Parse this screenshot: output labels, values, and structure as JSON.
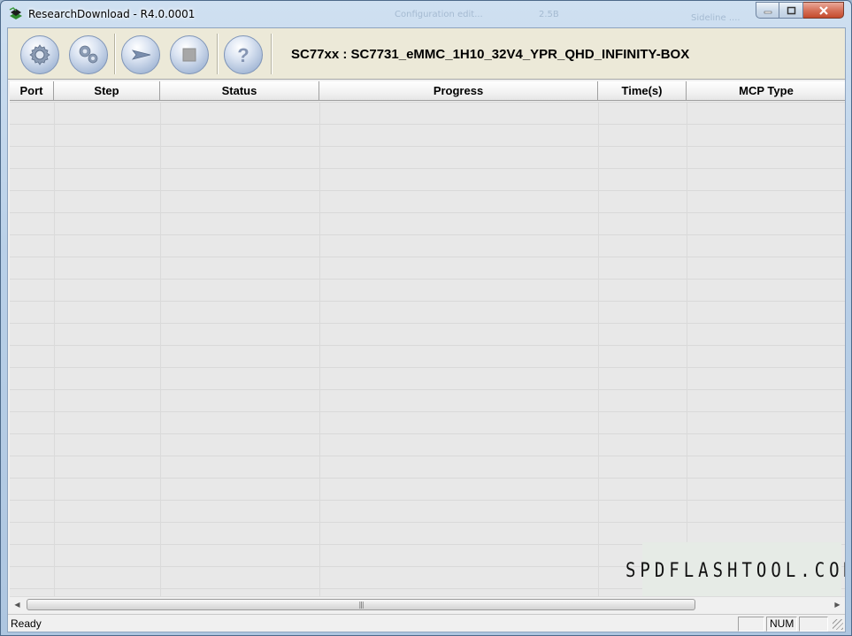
{
  "window": {
    "title": "ResearchDownload - R4.0.0001",
    "background_ghost": [
      "Configuration edit...",
      "2.5B",
      "Sideline ...."
    ]
  },
  "toolbar": {
    "buttons": [
      {
        "icon": "gear-icon",
        "label": "Load Packet"
      },
      {
        "icon": "gears-icon",
        "label": "Settings"
      },
      {
        "icon": "play-arrow-icon",
        "label": "Start Downloading"
      },
      {
        "icon": "stop-icon",
        "label": "Stop Downloading"
      },
      {
        "icon": "help-icon",
        "label": "About"
      }
    ],
    "device_label": "SC77xx : SC7731_eMMC_1H10_32V4_YPR_QHD_INFINITY-BOX"
  },
  "table": {
    "columns": [
      "Port",
      "Step",
      "Status",
      "Progress",
      "Time(s)",
      "MCP Type"
    ],
    "rows": []
  },
  "watermark": "SPDFLASHTOOL.COM",
  "statusbar": {
    "text": "Ready",
    "panels": [
      "",
      "NUM",
      ""
    ]
  },
  "colors": {
    "toolbar_bg": "#ece9d8",
    "grid_bg": "#e8e8e8",
    "title_gradient_top": "#cfe0f1"
  }
}
